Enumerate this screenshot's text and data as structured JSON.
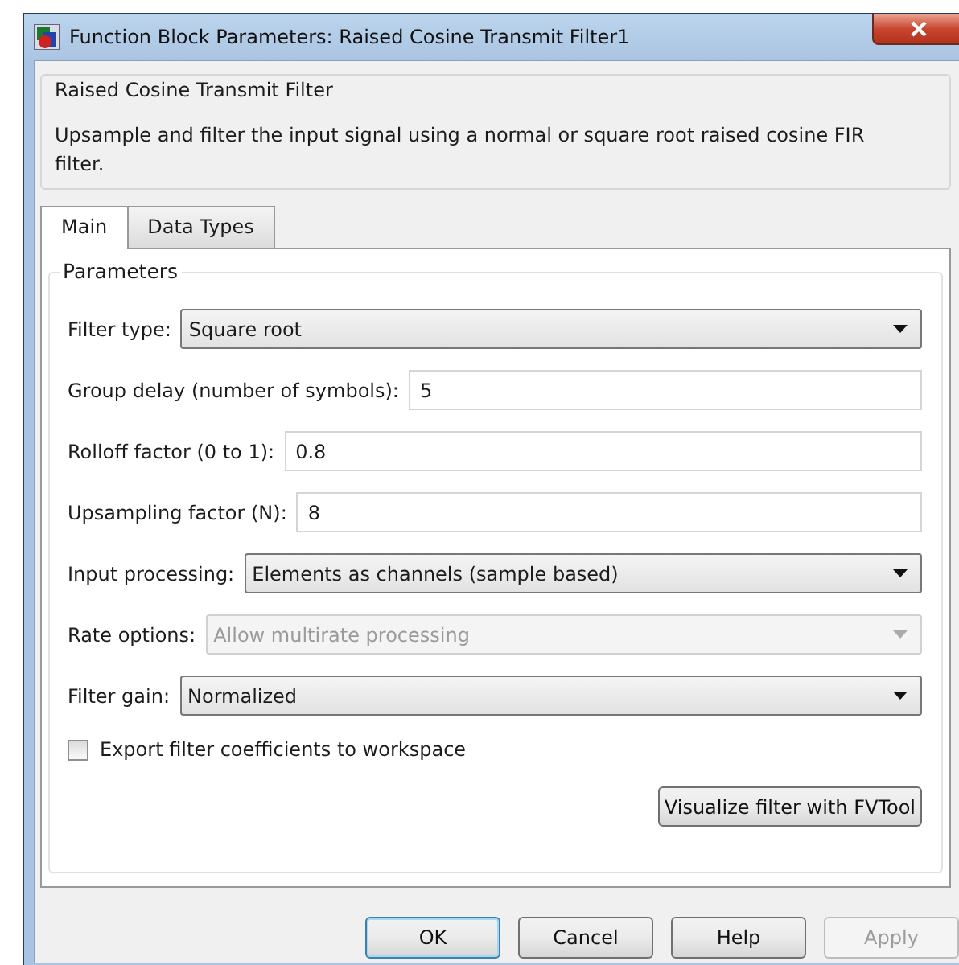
{
  "window": {
    "title": "Function Block Parameters: Raised Cosine Transmit Filter1"
  },
  "description": {
    "title": "Raised Cosine Transmit Filter",
    "text": "Upsample and filter the input signal using a normal or square root raised cosine FIR filter."
  },
  "tabs": [
    {
      "label": "Main",
      "selected": true
    },
    {
      "label": "Data Types",
      "selected": false
    }
  ],
  "parameters": {
    "title": "Parameters",
    "fields": [
      {
        "kind": "dropdown",
        "label": "Filter type:",
        "value": "Square root",
        "disabled": false
      },
      {
        "kind": "text",
        "label": "Group delay (number of symbols):",
        "value": "5",
        "disabled": false
      },
      {
        "kind": "text",
        "label": "Rolloff factor (0 to 1):",
        "value": "0.8",
        "disabled": false
      },
      {
        "kind": "text",
        "label": "Upsampling factor (N):",
        "value": "8",
        "disabled": false
      },
      {
        "kind": "dropdown",
        "label": "Input processing:",
        "value": "Elements as channels (sample based)",
        "disabled": false
      },
      {
        "kind": "dropdown",
        "label": "Rate options:",
        "value": "Allow multirate processing",
        "disabled": true
      },
      {
        "kind": "dropdown",
        "label": "Filter gain:",
        "value": "Normalized",
        "disabled": false
      }
    ],
    "checkbox": {
      "label": "Export filter coefficients to workspace",
      "checked": false
    },
    "action": {
      "label": "Visualize filter with FVTool"
    }
  },
  "buttons": [
    {
      "label": "OK",
      "default": true,
      "disabled": false
    },
    {
      "label": "Cancel",
      "default": false,
      "disabled": false
    },
    {
      "label": "Help",
      "default": false,
      "disabled": false
    },
    {
      "label": "Apply",
      "default": false,
      "disabled": true
    }
  ]
}
